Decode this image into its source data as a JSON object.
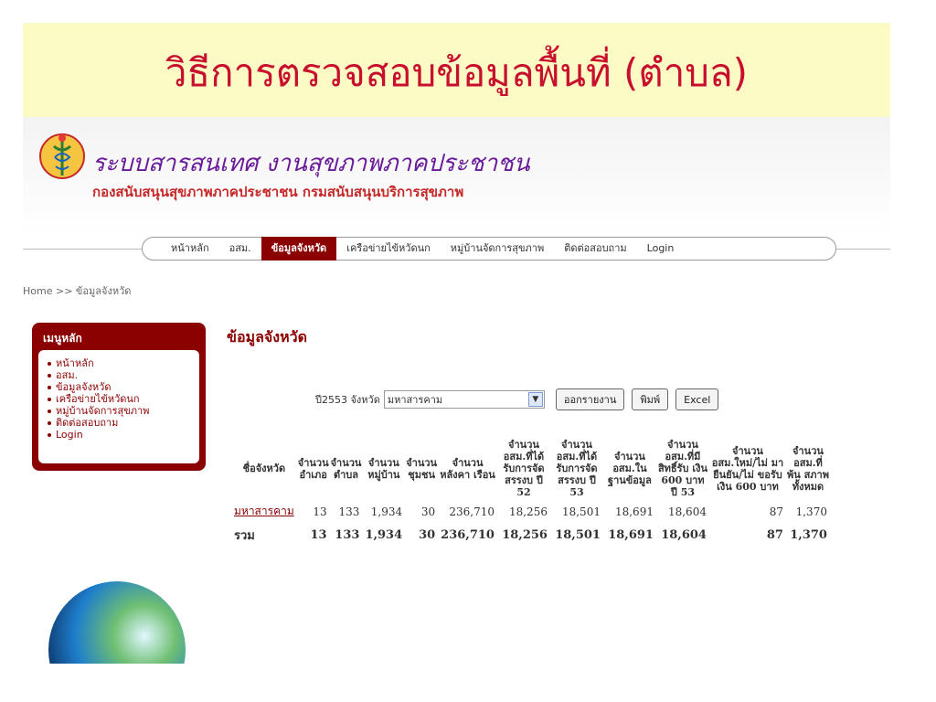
{
  "slide": {
    "title": "วิธีการตรวจสอบข้อมูลพื้นที่ (ตำบล)"
  },
  "site": {
    "name": "ระบบสารสนเทศ งานสุขภาพภาคประชาชน",
    "org": "กองสนับสนุนสุขภาพภาคประชาชน กรมสนับสนุนบริการสุขภาพ"
  },
  "nav": {
    "items": [
      "หน้าหลัก",
      "อสม.",
      "ข้อมูลจังหวัด",
      "เครือข่ายไข้หวัดนก",
      "หมู่บ้านจัดการสุขภาพ",
      "ติดต่อสอบถาม",
      "Login"
    ],
    "active": "ข้อมูลจังหวัด"
  },
  "breadcrumb": "Home >> ข้อมูลจังหวัด",
  "sidebar": {
    "title": "เมนูหลัก",
    "items": [
      "หน้าหลัก",
      "อสม.",
      "ข้อมูลจังหวัด",
      "เครือข่ายไข้หวัดนก",
      "หมู่บ้านจัดการสุขภาพ",
      "ติดต่อสอบถาม",
      "Login"
    ]
  },
  "content": {
    "title": "ข้อมูลจังหวัด",
    "filter_label": "ปี2553 จังหวัด",
    "province_selected": "มหาสารคาม",
    "report_button": "ออกรายงาน",
    "print_button": "พิมพ์",
    "excel_button": "Excel"
  },
  "table": {
    "headers": [
      "ชื่อจังหวัด",
      "จำนวน อำเภอ",
      "จำนวน ตำบล",
      "จำนวน หมู่บ้าน",
      "จำนวน ชุมชน",
      "จำนวน หลังคา เรือน",
      "จำนวน อสม.ที่ได้ รับการจัด สรรงบ ปี 52",
      "จำนวน อสม.ที่ได้ รับการจัด สรรงบ ปี 53",
      "จำนวน อสม.ใน ฐานข้อมูล",
      "จำนวน อสม.ที่มี สิทธิ์รับ เงิน 600 บาท ปี 53",
      "จำนวน อสม.ใหม่/ไม่ มายืนยัน/ไม่ ขอรับเงิน 600 บาท",
      "จำนวน อสม.ที่ พ้น สภาพ ทั้งหมด"
    ],
    "rows": [
      [
        "มหาสารคาม",
        "13",
        "133",
        "1,934",
        "30",
        "236,710",
        "18,256",
        "18,501",
        "18,691",
        "18,604",
        "87",
        "1,370"
      ]
    ],
    "total": [
      "รวม",
      "13",
      "133",
      "1,934",
      "30",
      "236,710",
      "18,256",
      "18,501",
      "18,691",
      "18,604",
      "87",
      "1,370"
    ]
  }
}
